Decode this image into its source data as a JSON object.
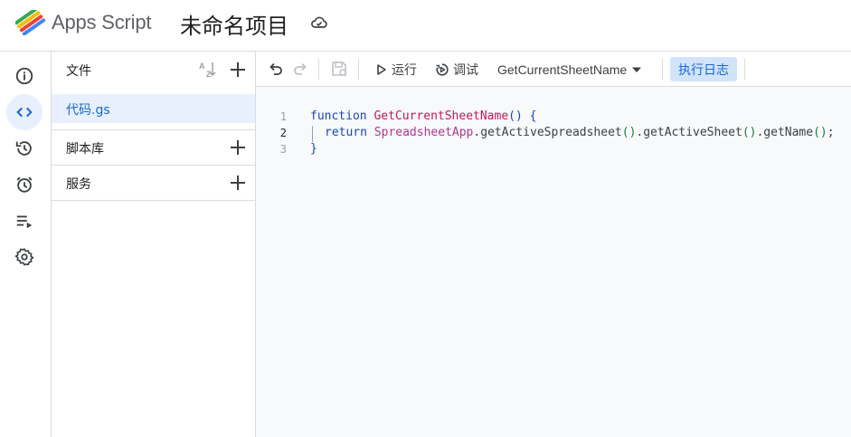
{
  "header": {
    "app_name": "Apps Script",
    "project_title": "未命名项目"
  },
  "rail": {
    "items": [
      {
        "icon": "info-icon",
        "label": "概览"
      },
      {
        "icon": "code-icon",
        "label": "编辑器",
        "active": true
      },
      {
        "icon": "history-icon",
        "label": "历史记录"
      },
      {
        "icon": "alarm-icon",
        "label": "触发器"
      },
      {
        "icon": "executions-icon",
        "label": "执行"
      },
      {
        "icon": "gear-icon",
        "label": "设置"
      }
    ]
  },
  "files": {
    "title": "文件",
    "items": [
      {
        "name": "代码.gs",
        "selected": true
      }
    ],
    "sections": [
      {
        "label": "脚本库"
      },
      {
        "label": "服务"
      }
    ]
  },
  "toolbar": {
    "run_label": "运行",
    "debug_label": "调试",
    "function_name": "GetCurrentSheetName",
    "log_label": "执行日志"
  },
  "editor": {
    "lines": [
      {
        "number": "1"
      },
      {
        "number": "2"
      },
      {
        "number": "3"
      }
    ],
    "tokens": {
      "kw_function": "function",
      "fn_name": "GetCurrentSheetName",
      "paren_open_brace": "() {",
      "kw_return": "return",
      "cls_app": "SpreadsheetApp",
      "m1": ".getActiveSpreadsheet",
      "p1": "()",
      "m2": ".getActiveSheet",
      "p2": "()",
      "m3": ".getName",
      "p3": "()",
      "semi": ";",
      "close_brace": "}"
    }
  },
  "colors": {
    "accent": "#1967d2",
    "selection_bg": "#e8f0fe",
    "keyword": "#1a47b0",
    "function": "#c2185b",
    "bracket": "#1a7f37"
  }
}
